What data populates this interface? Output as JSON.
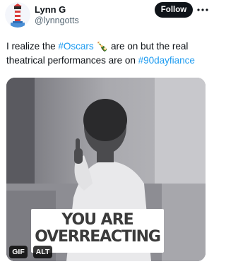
{
  "tweet": {
    "author_name": "Lynn G",
    "author_handle": "@lynngotts",
    "follow_label": "Follow",
    "text_part1": "I realize the ",
    "hashtag1": "#Oscars",
    "emoji": "🍾",
    "text_part2": " are on but the real theatrical performances are on ",
    "hashtag2": "#90dayfiance"
  },
  "media": {
    "caption_line1": "YOU ARE",
    "caption_line2": "OVERREACTING",
    "gif_badge": "GIF",
    "alt_badge": "ALT"
  },
  "colors": {
    "link": "#1d9bf0",
    "text": "#0f1419",
    "secondary": "#536471",
    "button": "#0f1419"
  },
  "icons": {
    "avatar": "lighthouse-avatar",
    "more": "more-options-icon"
  }
}
